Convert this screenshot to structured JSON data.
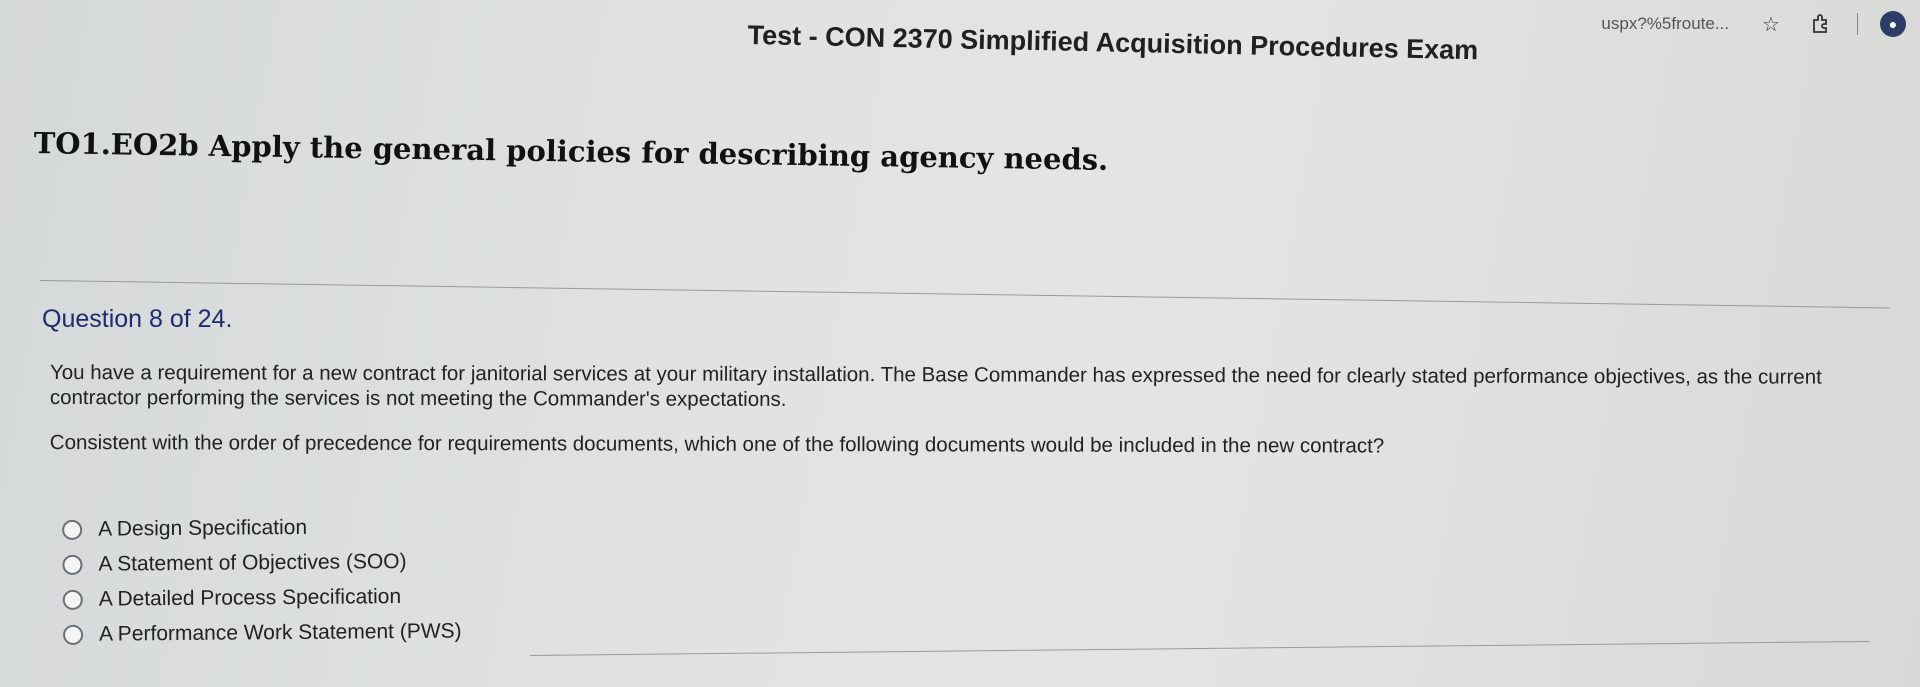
{
  "browser": {
    "url_fragment": "uspx?%5froute...",
    "icons": [
      "star-icon",
      "extension-icon",
      "profile-icon"
    ]
  },
  "exam": {
    "title": "Test - CON 2370 Simplified Acquisition Procedures Exam"
  },
  "objective": {
    "text": "TO1.EO2b Apply the general policies for describing agency needs."
  },
  "question": {
    "number_label": "Question 8 of 24.",
    "scenario": "You have a requirement for a new contract for janitorial services at your military installation. The Base Commander has expressed the need for clearly stated performance objectives, as the current contractor performing the services is not meeting the Commander's expectations.",
    "prompt": "Consistent with the order of precedence for requirements documents, which one of the following documents would be included in the new contract?",
    "options": [
      {
        "label": "A Design Specification",
        "selected": false
      },
      {
        "label": "A Statement of Objectives (SOO)",
        "selected": false
      },
      {
        "label": "A Detailed Process Specification",
        "selected": false
      },
      {
        "label": "A Performance Work Statement (PWS)",
        "selected": false
      }
    ]
  },
  "colors": {
    "question_number": "#1e2c6e",
    "text": "#222222",
    "background": "#e0e2e2"
  }
}
